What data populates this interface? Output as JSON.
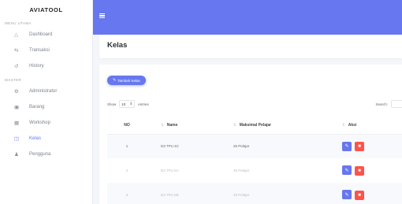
{
  "brand": "AVIATOOL",
  "sidebar": {
    "sections": [
      {
        "label": "MENU UTAMA",
        "items": [
          {
            "label": "Dashboard",
            "icon": "fire-icon"
          },
          {
            "label": "Transaksi",
            "icon": "exchange-icon"
          },
          {
            "label": "History",
            "icon": "history-icon"
          }
        ]
      },
      {
        "label": "MASTER",
        "items": [
          {
            "label": "Administrator",
            "icon": "users-cog-icon"
          },
          {
            "label": "Barang",
            "icon": "boxes-icon"
          },
          {
            "label": "Workshop",
            "icon": "warehouse-icon"
          },
          {
            "label": "Kelas",
            "icon": "chalkboard-icon",
            "active": true
          },
          {
            "label": "Pengguna",
            "icon": "user-icon"
          }
        ]
      }
    ]
  },
  "page": {
    "title": "Kelas"
  },
  "toolbar": {
    "add_label": "Tambah Kelas"
  },
  "table_controls": {
    "show_label": "Show",
    "entries_value": "10",
    "entries_label": "entries",
    "search_label": "Search:"
  },
  "table": {
    "headers": {
      "no": "NO",
      "name": "Name",
      "max": "Maksimal Pelajar",
      "aksi": "Aksi"
    },
    "rows": [
      {
        "no": "1",
        "name": "D3 TPU 4C",
        "max": "25 Pelajar"
      },
      {
        "no": "2",
        "name": "D3 TPU 5A",
        "max": "25 Pelajar"
      },
      {
        "no": "3",
        "name": "D3 TPU 5B",
        "max": "25 Pelajar"
      }
    ]
  },
  "colors": {
    "accent": "#6777ef",
    "danger": "#fc544b",
    "sidebar_bg": "#ffffff",
    "page_bg": "#f4f6f9"
  }
}
